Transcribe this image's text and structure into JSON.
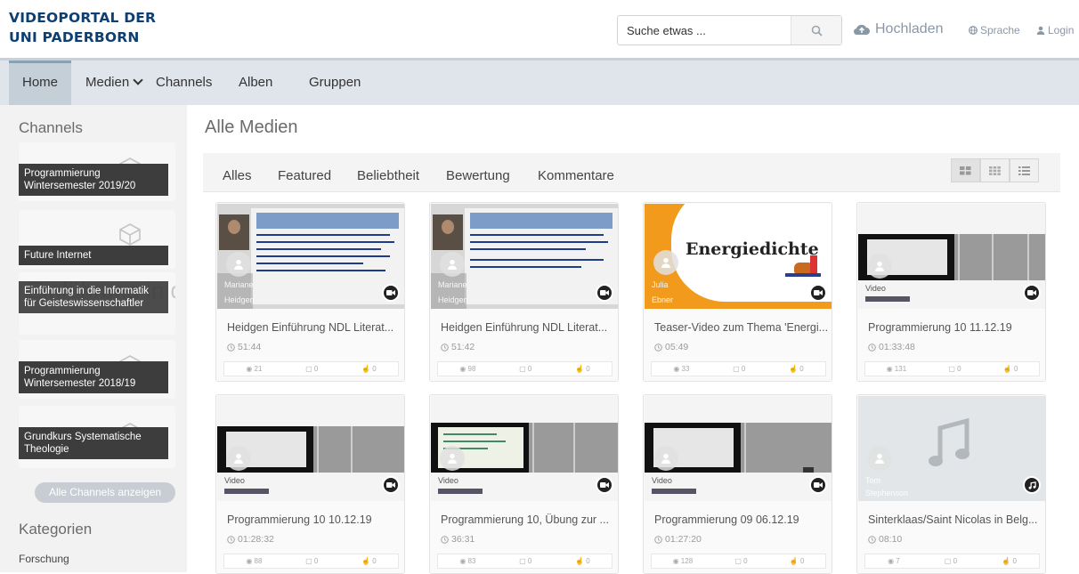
{
  "header": {
    "logo_line1": "VIDEOPORTAL DER",
    "logo_line2": "UNI PADERBORN",
    "search_placeholder": "Suche etwas ...",
    "upload_label": "Hochladen",
    "language_label": "Sprache",
    "login_label": "Login",
    "brand_color": "#0d3f73"
  },
  "nav": {
    "home": "Home",
    "media": "Medien",
    "channels": "Channels",
    "albums": "Alben",
    "groups": "Gruppen"
  },
  "sidebar": {
    "channels_title": "Channels",
    "channels": [
      "Programmierung Wintersemester 2019/20",
      "Future Internet",
      "Einführung in die Informatik für Geisteswissenschaftler",
      "Programmierung Wintersemester 2018/19",
      "Grundkurs Systematische Theologie"
    ],
    "bg_text": "Einführung in die Informatik",
    "all_channels": "Alle Channels anzeigen",
    "categories_title": "Kategorien",
    "category_first": "Forschung"
  },
  "main": {
    "title": "Alle Medien",
    "filters": [
      "Alles",
      "Featured",
      "Beliebtheit",
      "Bewertung",
      "Kommentare"
    ],
    "media": [
      {
        "title": "Heidgen Einführung NDL Literat...",
        "duration": "51:44",
        "views": "21",
        "comments": "0",
        "likes": "0",
        "user1": "Mariane",
        "user2": "Heidgen",
        "type": "video-icon"
      },
      {
        "title": "Heidgen Einführung NDL Literat...",
        "duration": "51:42",
        "views": "98",
        "comments": "0",
        "likes": "0",
        "user1": "Mariane",
        "user2": "Heidgen",
        "type": "video-icon"
      },
      {
        "title": "Teaser-Video zum Thema 'Energi...",
        "duration": "05:49",
        "views": "33",
        "comments": "0",
        "likes": "0",
        "user1": "Julia",
        "user2": "Ebner",
        "thumb_text": "Energiedichte",
        "type": "video-icon"
      },
      {
        "title": "Programmierung 10 11.12.19",
        "duration": "01:33:48",
        "views": "131",
        "comments": "0",
        "likes": "0",
        "user1": "Video",
        "user2": "",
        "type": "video-icon"
      },
      {
        "title": "Programmierung 10 10.12.19",
        "duration": "01:28:32",
        "views": "88",
        "comments": "0",
        "likes": "0",
        "user1": "Video",
        "user2": "",
        "type": "video-icon"
      },
      {
        "title": "Programmierung 10, Übung zur ...",
        "duration": "36:31",
        "views": "83",
        "comments": "0",
        "likes": "0",
        "user1": "Video",
        "user2": "",
        "type": "video-icon"
      },
      {
        "title": "Programmierung 09 06.12.19",
        "duration": "01:27:20",
        "views": "128",
        "comments": "0",
        "likes": "0",
        "user1": "Video",
        "user2": "",
        "type": "video-icon"
      },
      {
        "title": "Sinterklaas/Saint Nicolas in Belg...",
        "duration": "08:10",
        "views": "7",
        "comments": "0",
        "likes": "0",
        "user1": "Tom",
        "user2": "Stephenson",
        "type": "music-icon"
      }
    ]
  }
}
